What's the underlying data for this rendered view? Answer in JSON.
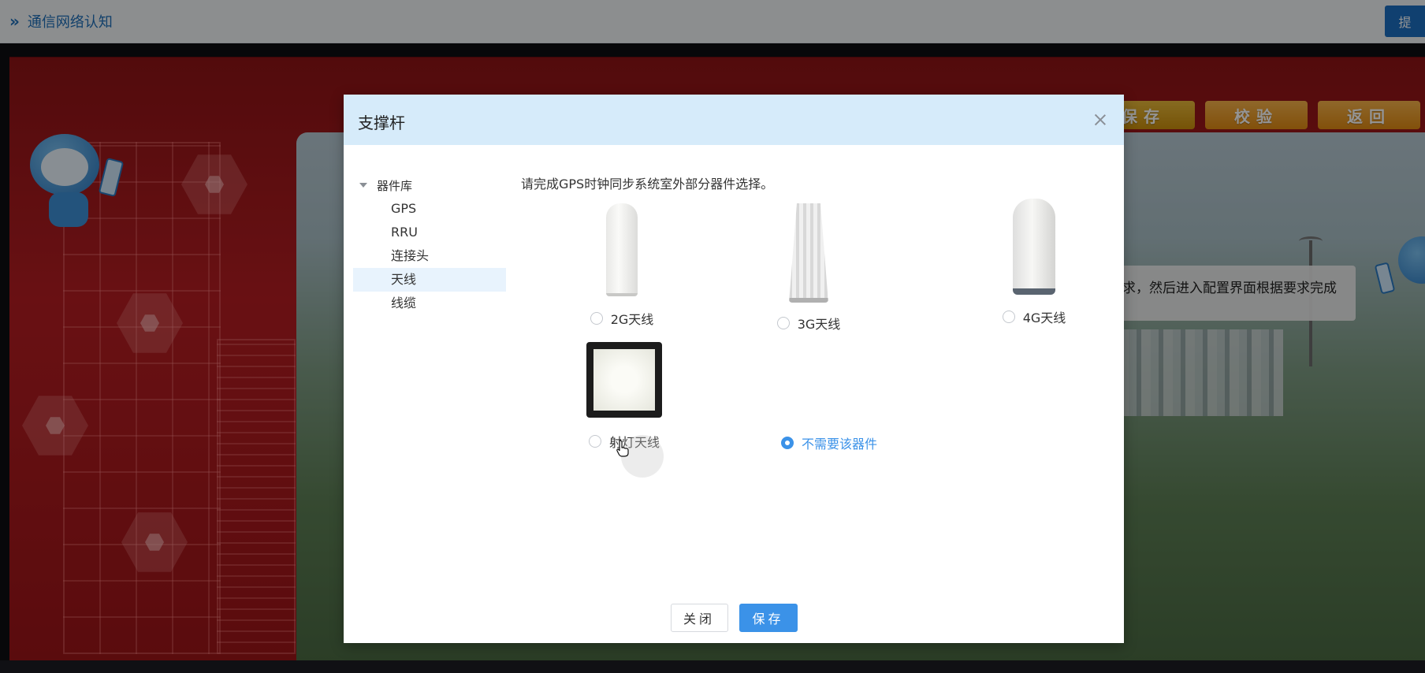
{
  "topbar": {
    "breadcrumb_icon": "»",
    "breadcrumb_title": "通信网络认知",
    "submit_label": "提"
  },
  "stage": {
    "buttons": {
      "save": "保存",
      "check": "校验",
      "back": "返回"
    },
    "instruction_text": "求，然后进入配置界面根据要求完成"
  },
  "modal": {
    "title": "支撑杆",
    "tree": {
      "root_label": "器件库",
      "items": [
        {
          "label": "GPS",
          "active": false
        },
        {
          "label": "RRU",
          "active": false
        },
        {
          "label": "连接头",
          "active": false
        },
        {
          "label": "天线",
          "active": true
        },
        {
          "label": "线缆",
          "active": false
        }
      ]
    },
    "prompt": "请完成GPS时钟同步系统室外部分器件选择。",
    "options": [
      {
        "label": "2G天线",
        "checked": false,
        "icon": "antenna-2g-icon"
      },
      {
        "label": "3G天线",
        "checked": false,
        "icon": "antenna-3g-icon"
      },
      {
        "label": "4G天线",
        "checked": false,
        "icon": "antenna-4g-icon"
      },
      {
        "label": "射灯天线",
        "checked": false,
        "icon": "panel-antenna-icon"
      },
      {
        "label": "不需要该器件",
        "checked": true,
        "icon": ""
      }
    ],
    "footer": {
      "close_label": "关闭",
      "save_label": "保存"
    }
  },
  "colors": {
    "primary": "#3b92e8",
    "header_bg": "#d6ebfa",
    "stage_red": "#b51d22",
    "stage_button": "#e08a13"
  }
}
